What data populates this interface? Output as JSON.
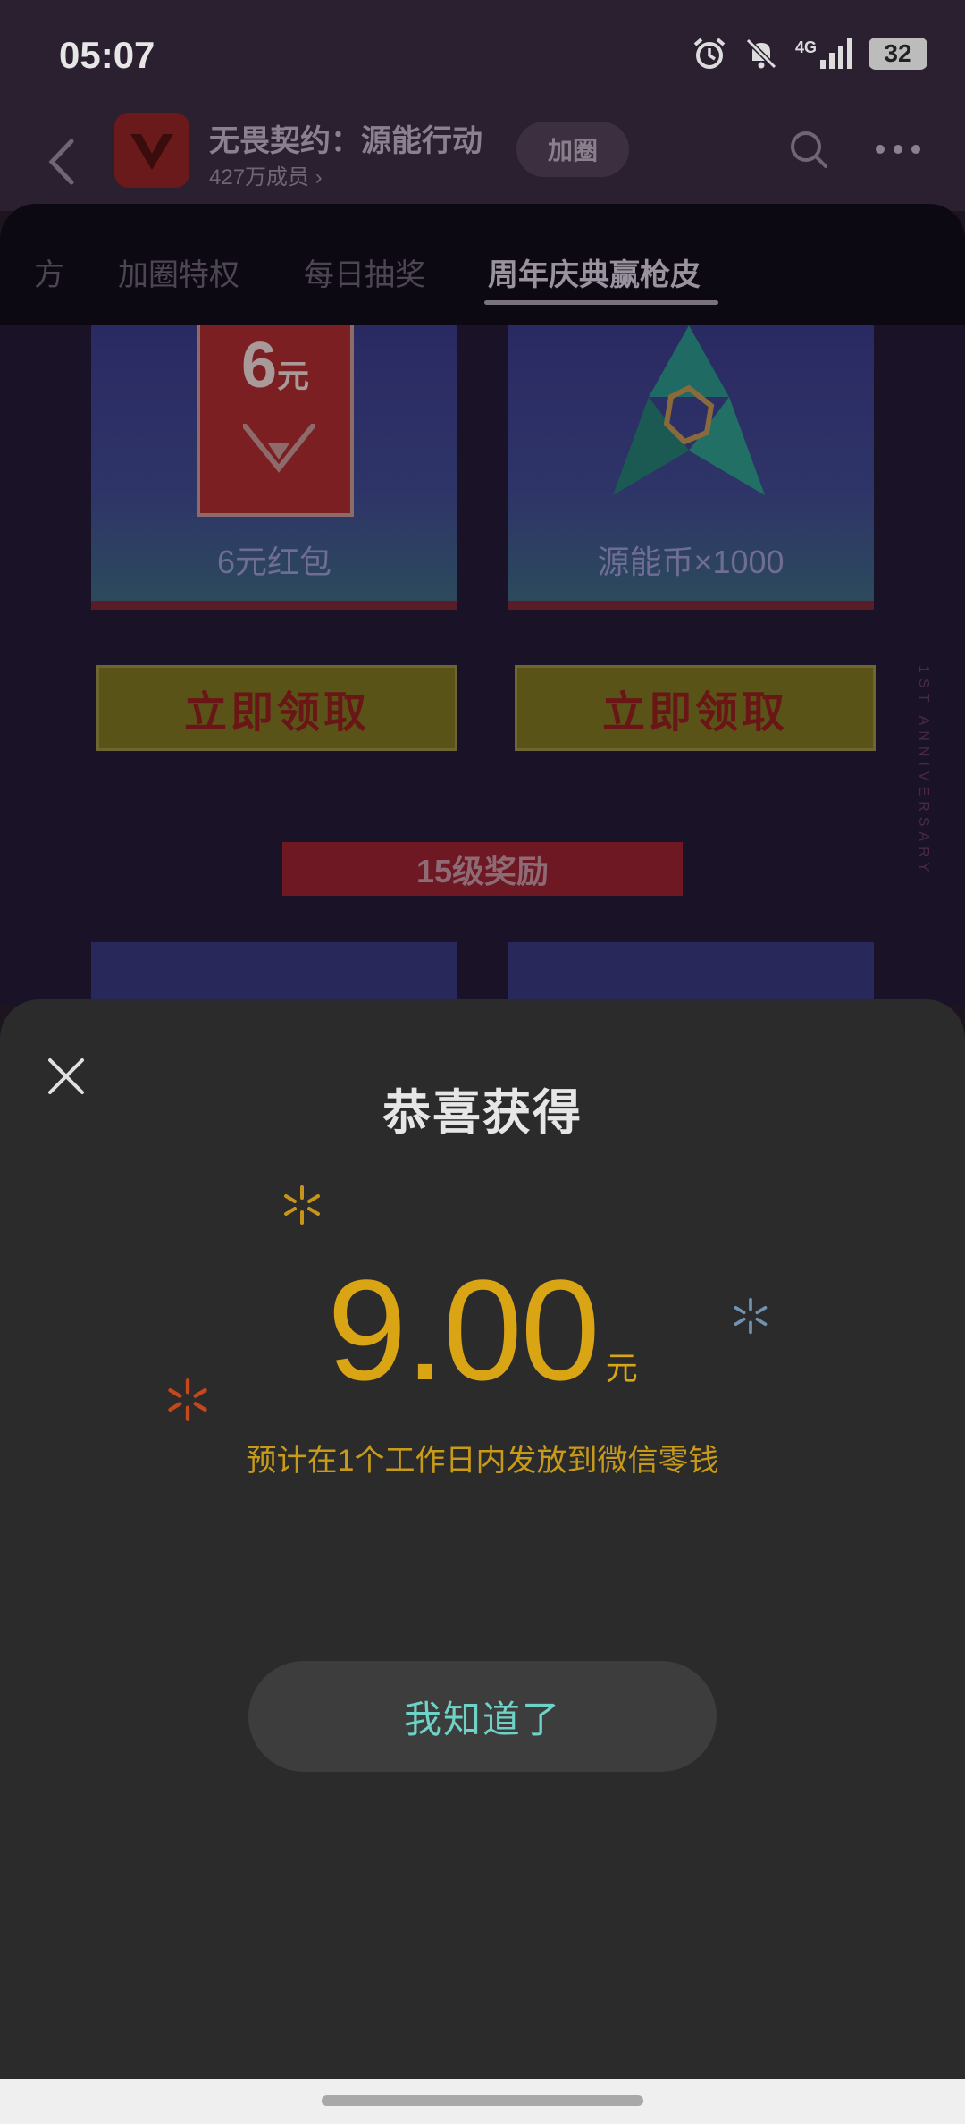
{
  "status_bar": {
    "time": "05:07",
    "network": "4G",
    "battery": "32",
    "icons": [
      "alarm-icon",
      "bell-off-icon",
      "signal-icon",
      "battery-icon"
    ]
  },
  "header": {
    "app_name": "无畏契约：源能行动",
    "members": "427万成员",
    "join_label": "加圈",
    "icons": [
      "back-icon",
      "search-icon",
      "more-icon"
    ]
  },
  "tabs": [
    {
      "label": "方"
    },
    {
      "label": "加圈特权"
    },
    {
      "label": "每日抽奖"
    },
    {
      "label": "周年庆典赢枪皮",
      "active": true
    }
  ],
  "rewards": {
    "items": [
      {
        "name": "6元红包",
        "badge_amount": "6",
        "badge_unit": "元",
        "claim_label": "立即领取"
      },
      {
        "name": "源能币×1000",
        "claim_label": "立即领取"
      }
    ],
    "level_banner": "15级奖励",
    "side_text": "1ST ANNIVERSARY"
  },
  "dialog": {
    "title": "恭喜获得",
    "amount": "9.00",
    "unit": "元",
    "note": "预计在1个工作日内发放到微信零钱",
    "confirm_label": "我知道了"
  },
  "colors": {
    "accent_gold": "#d9a515",
    "button_text_teal": "#6fd2c6",
    "sheet_bg": "#2b2b2b"
  }
}
